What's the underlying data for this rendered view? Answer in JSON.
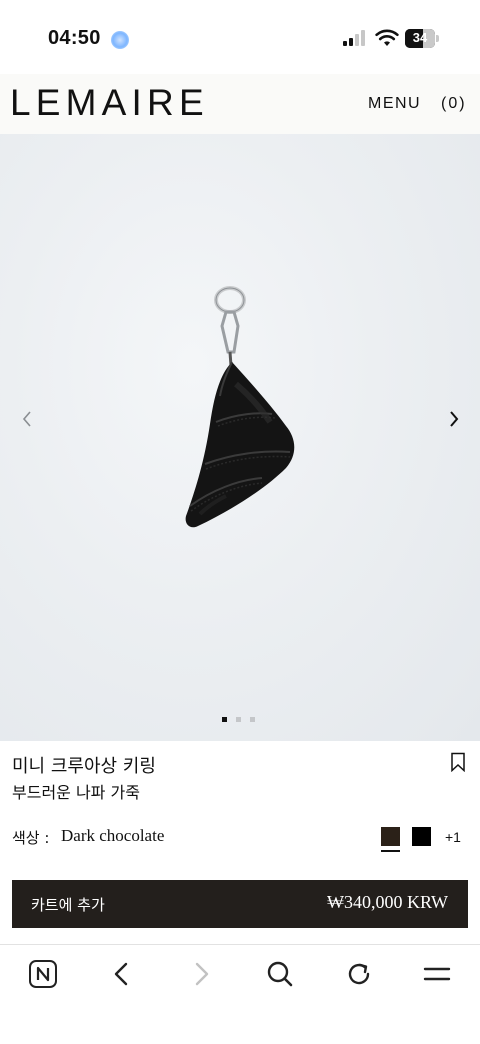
{
  "status_bar": {
    "time": "04:50",
    "battery": "34"
  },
  "header": {
    "logo": "LEMAIRE",
    "menu_label": "MENU",
    "cart_label": "(0)"
  },
  "gallery": {
    "image_subject": "black leather croissant key ring",
    "page_count": 3,
    "active_page": 1
  },
  "product": {
    "name": "미니 크루아상 키링",
    "material": "부드러운 나파 가죽",
    "color_label": "색상 :",
    "color_value": "Dark chocolate",
    "swatches": [
      "#2b2118",
      "#000000"
    ],
    "more_colors": "+1"
  },
  "cart": {
    "add_label": "카트에 추가",
    "price": "₩340,000 KRW"
  },
  "toolbar": {
    "icons": [
      "naver-icon",
      "back-icon",
      "forward-icon",
      "search-icon",
      "reload-icon",
      "menu-icon"
    ]
  }
}
